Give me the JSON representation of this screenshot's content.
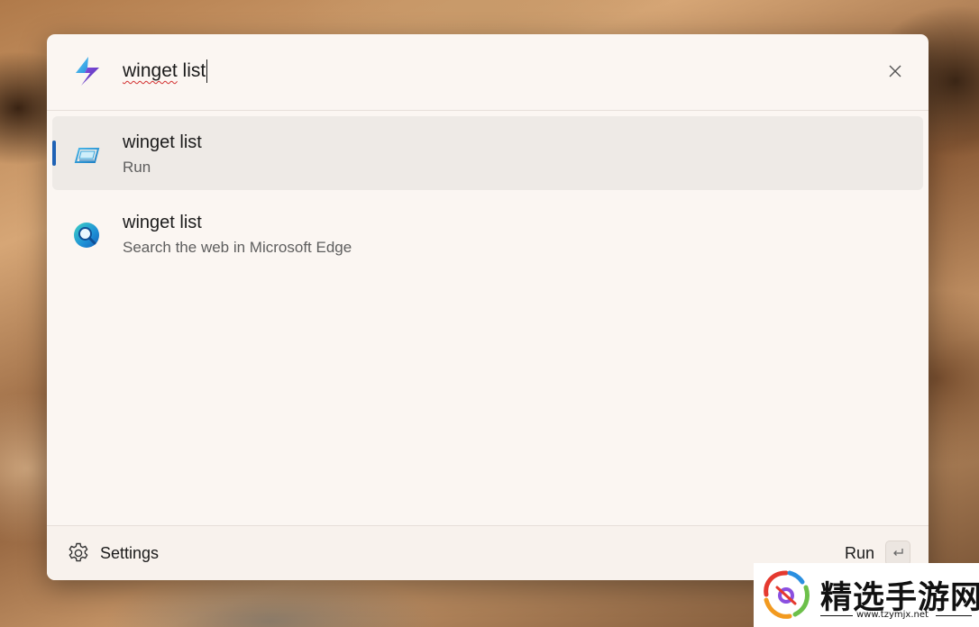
{
  "search": {
    "query_underlined": "winget",
    "query_rest": " list"
  },
  "results": [
    {
      "title": "winget list",
      "subtitle": "Run",
      "icon": "terminal-icon",
      "selected": true
    },
    {
      "title": "winget list",
      "subtitle": "Search the web in Microsoft Edge",
      "icon": "web-search-icon",
      "selected": false
    }
  ],
  "footer": {
    "settings_label": "Settings",
    "run_label": "Run",
    "enter_icon": "enter-key-icon"
  },
  "watermark": {
    "title": "精选手游网",
    "url": "www.tzymjx.net"
  },
  "colors": {
    "accent": "#1f62b5",
    "panel_bg": "#fbf6f2",
    "selected_bg": "#eeeae6",
    "spellcheck": "#d22f2f"
  }
}
